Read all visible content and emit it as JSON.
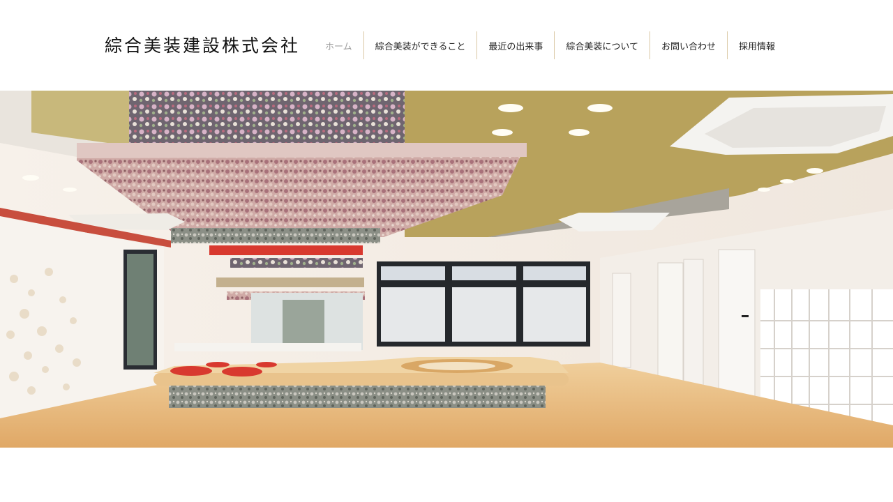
{
  "site": {
    "logo_text": "綜合美装建設株式会社"
  },
  "nav": {
    "items": [
      {
        "label": "ホーム",
        "active": true
      },
      {
        "label": "綜合美装ができること",
        "active": false
      },
      {
        "label": "最近の出来事",
        "active": false
      },
      {
        "label": "綜合美装について",
        "active": false
      },
      {
        "label": "お問い合わせ",
        "active": false
      },
      {
        "label": "採用情報",
        "active": false
      }
    ]
  },
  "hero": {
    "subject": "interior-photo",
    "colors": {
      "floor": "#e6b97c",
      "wall": "#f4efe9",
      "ceiling_olive": "#b9a35e",
      "accent_red": "#d8392f",
      "floral": "#c9a2a0"
    }
  }
}
